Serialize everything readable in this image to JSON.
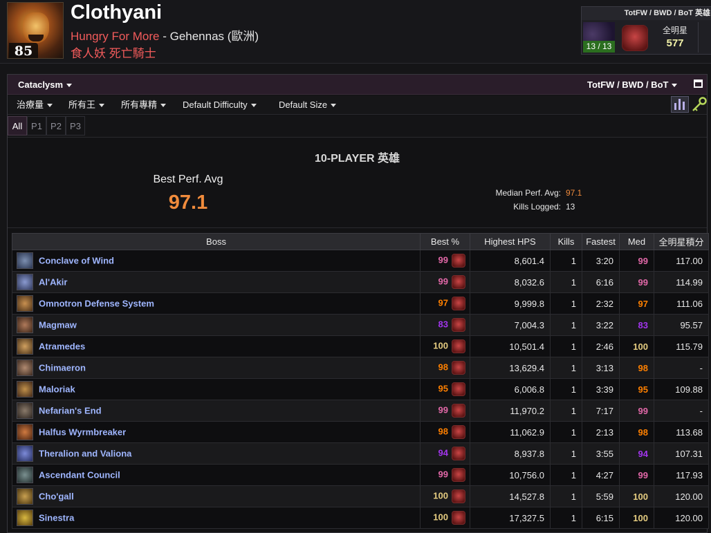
{
  "character": {
    "name": "Clothyani",
    "level": "85",
    "guild": "Hungry For More",
    "separator": " - ",
    "server": "Gehennas (歐洲)",
    "race_class": "食人妖 死亡騎士"
  },
  "zone_box": {
    "title": "TotFW / BWD / BoT 英雄",
    "progress": "13 / 13",
    "allstar_label": "全明星",
    "allstar_value": "577"
  },
  "topbar": {
    "expansion": "Cataclysm",
    "zone": "TotFW / BWD / BoT"
  },
  "filters": {
    "role": "治療量",
    "bosses": "所有王",
    "specs": "所有專精",
    "difficulty": "Default Difficulty",
    "size": "Default Size"
  },
  "tabs": [
    "All",
    "P1",
    "P2",
    "P3"
  ],
  "summary": {
    "difficulty_title": "10-PLAYER 英雄",
    "best_label": "Best Perf. Avg",
    "best_value": "97.1",
    "median_label": "Median Perf. Avg:",
    "median_value": "97.1",
    "kills_label": "Kills Logged:",
    "kills_value": "13"
  },
  "table": {
    "headers": [
      "Boss",
      "Best %",
      "Highest HPS",
      "Kills",
      "Fastest",
      "Med",
      "全明星積分"
    ],
    "rows": [
      {
        "boss": "Conclave of Wind",
        "best": "99",
        "hps": "8,601.4",
        "kills": "1",
        "fastest": "3:20",
        "med": "99",
        "score": "117.00"
      },
      {
        "boss": "Al'Akir",
        "best": "99",
        "hps": "8,032.6",
        "kills": "1",
        "fastest": "6:16",
        "med": "99",
        "score": "114.99"
      },
      {
        "boss": "Omnotron Defense System",
        "best": "97",
        "hps": "9,999.8",
        "kills": "1",
        "fastest": "2:32",
        "med": "97",
        "score": "111.06"
      },
      {
        "boss": "Magmaw",
        "best": "83",
        "hps": "7,004.3",
        "kills": "1",
        "fastest": "3:22",
        "med": "83",
        "score": "95.57"
      },
      {
        "boss": "Atramedes",
        "best": "100",
        "hps": "10,501.4",
        "kills": "1",
        "fastest": "2:46",
        "med": "100",
        "score": "115.79"
      },
      {
        "boss": "Chimaeron",
        "best": "98",
        "hps": "13,629.4",
        "kills": "1",
        "fastest": "3:13",
        "med": "98",
        "score": "-"
      },
      {
        "boss": "Maloriak",
        "best": "95",
        "hps": "6,006.8",
        "kills": "1",
        "fastest": "3:39",
        "med": "95",
        "score": "109.88"
      },
      {
        "boss": "Nefarian's End",
        "best": "99",
        "hps": "11,970.2",
        "kills": "1",
        "fastest": "7:17",
        "med": "99",
        "score": "-"
      },
      {
        "boss": "Halfus Wyrmbreaker",
        "best": "98",
        "hps": "11,062.9",
        "kills": "1",
        "fastest": "2:13",
        "med": "98",
        "score": "113.68"
      },
      {
        "boss": "Theralion and Valiona",
        "best": "94",
        "hps": "8,937.8",
        "kills": "1",
        "fastest": "3:55",
        "med": "94",
        "score": "107.31"
      },
      {
        "boss": "Ascendant Council",
        "best": "99",
        "hps": "10,756.0",
        "kills": "1",
        "fastest": "4:27",
        "med": "99",
        "score": "117.93"
      },
      {
        "boss": "Cho'gall",
        "best": "100",
        "hps": "14,527.8",
        "kills": "1",
        "fastest": "5:59",
        "med": "100",
        "score": "120.00"
      },
      {
        "boss": "Sinestra",
        "best": "100",
        "hps": "17,327.5",
        "kills": "1",
        "fastest": "6:15",
        "med": "100",
        "score": "120.00"
      }
    ]
  },
  "colors": {
    "parse_legendary": "#e5cc80",
    "parse_astounding": "#e268a8",
    "parse_legendary_orange": "#ff8000",
    "parse_epic": "#a335ee",
    "boss_name": "#9fb6ff",
    "hps_value": "#e8e8a8",
    "median_value": "#f08b3c",
    "best_value": "#f08b3c",
    "guild": "#f25b5b"
  }
}
